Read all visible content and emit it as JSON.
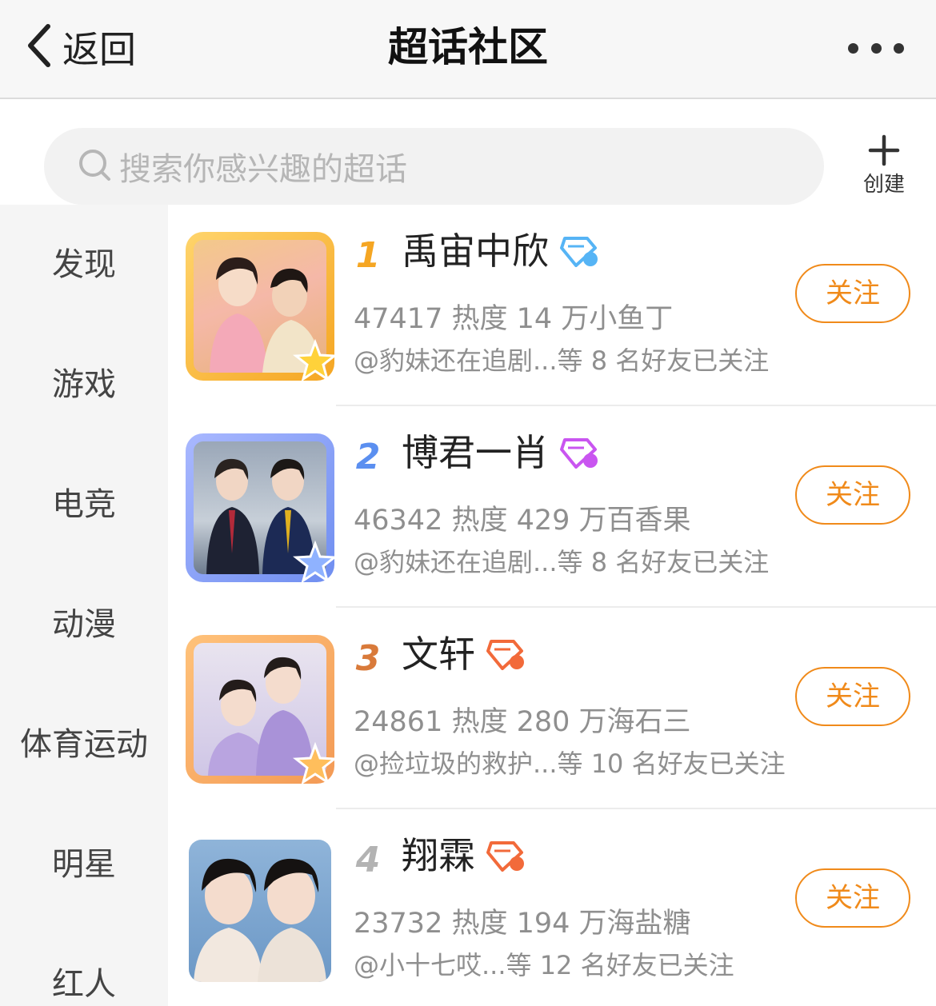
{
  "header": {
    "back_label": "返回",
    "title": "超话社区"
  },
  "search": {
    "placeholder": "搜索你感兴趣的超话"
  },
  "create_label": "创建",
  "sidebar": {
    "items": [
      {
        "label": "发现"
      },
      {
        "label": "游戏"
      },
      {
        "label": "电竞"
      },
      {
        "label": "动漫"
      },
      {
        "label": "体育运动"
      },
      {
        "label": "明星"
      },
      {
        "label": "红人"
      }
    ]
  },
  "communities": [
    {
      "rank": "1",
      "rank_color": "#f5a623",
      "name": "禹宙中欣",
      "badge_color": "#56b4f5",
      "stats": "47417 热度 14 万小鱼丁",
      "friends": "@豹妹还在追剧...等 8 名好友已关注",
      "follow_label": "关注",
      "frame_color": "#f8b93c"
    },
    {
      "rank": "2",
      "rank_color": "#5b8ff0",
      "name": "博君一肖",
      "badge_color": "#c955f0",
      "stats": "46342 热度 429 万百香果",
      "friends": "@豹妹还在追剧...等 8 名好友已关注",
      "follow_label": "关注",
      "frame_color": "#7d9cf3"
    },
    {
      "rank": "3",
      "rank_color": "#d97a3a",
      "name": "文轩",
      "badge_color": "#f26a3a",
      "stats": "24861 热度 280 万海石三",
      "friends": "@捡垃圾的救护...等 10 名好友已关注",
      "follow_label": "关注",
      "frame_color": "#f4a764"
    },
    {
      "rank": "4",
      "rank_color": "#b3b3b3",
      "name": "翔霖",
      "badge_color": "#f26a3a",
      "stats": "23732 热度 194 万海盐糖",
      "friends": "@小十七哎...等 12 名好友已关注",
      "follow_label": "关注",
      "frame_color": ""
    }
  ],
  "colors": {
    "accent": "#f08a1a",
    "muted_text": "#8f8f8f"
  }
}
